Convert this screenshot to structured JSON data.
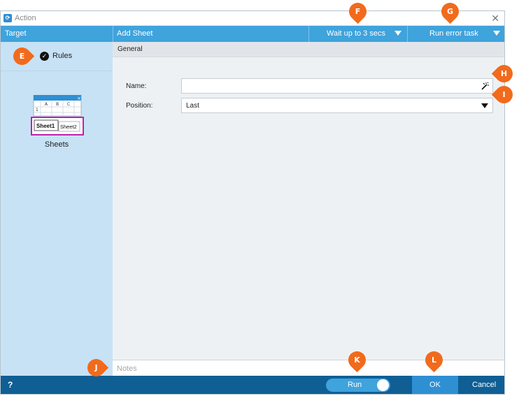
{
  "window": {
    "title": "Action",
    "close_symbol": "✕"
  },
  "toolbar": {
    "target_label": "Target",
    "action_label": "Add Sheet",
    "wait_dropdown": "Wait up to 3 secs",
    "error_dropdown": "Run error task"
  },
  "left_pane": {
    "rules_label": "Rules",
    "sheets_label": "Sheets",
    "thumb": {
      "columns": [
        "A",
        "B",
        "C"
      ],
      "row_number": "1",
      "tabs": [
        "Sheet1",
        "Sheet2"
      ]
    }
  },
  "main": {
    "section_label": "General",
    "fields": {
      "name_label": "Name:",
      "name_value": "",
      "position_label": "Position:",
      "position_value": "Last"
    },
    "notes_placeholder": "Notes"
  },
  "footer": {
    "help_label": "?",
    "run_label": "Run",
    "ok_label": "OK",
    "cancel_label": "Cancel"
  },
  "callouts": [
    "E",
    "F",
    "G",
    "H",
    "I",
    "J",
    "K",
    "L"
  ],
  "colors": {
    "accent_blue": "#3fa3dc",
    "footer_blue": "#0f5f94",
    "ok_blue": "#2e8fd3",
    "left_pane": "#c7e2f5",
    "callout_orange": "#f26a1b",
    "highlight_magenta": "#c020b0"
  }
}
